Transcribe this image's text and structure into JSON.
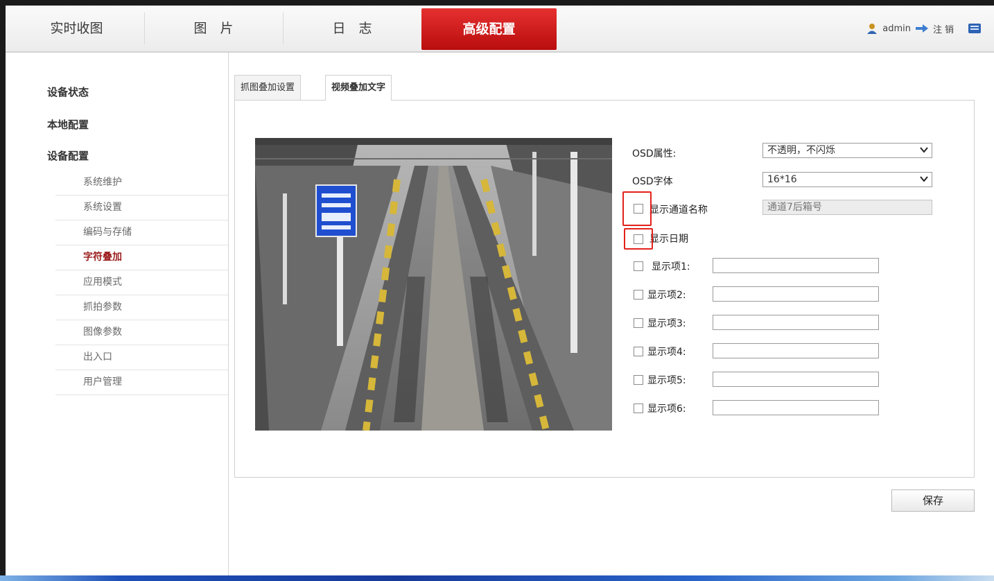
{
  "nav": {
    "tabs": [
      {
        "label": "实时收图"
      },
      {
        "label": "图　片"
      },
      {
        "label": "日　志"
      },
      {
        "label": "高级配置"
      }
    ],
    "user": "admin",
    "logout": "注销"
  },
  "sidebar": {
    "sections": [
      "设备状态",
      "本地配置",
      "设备配置"
    ],
    "items": [
      {
        "label": "系统维护"
      },
      {
        "label": "系统设置"
      },
      {
        "label": "编码与存储"
      },
      {
        "label": "字符叠加"
      },
      {
        "label": "应用模式"
      },
      {
        "label": "抓拍参数"
      },
      {
        "label": "图像参数"
      },
      {
        "label": "出入口"
      },
      {
        "label": "用户管理"
      }
    ],
    "current": "字符叠加"
  },
  "content": {
    "tabs": [
      {
        "label": "抓图叠加设置"
      },
      {
        "label": "视频叠加文字"
      }
    ],
    "active_tab": "视频叠加文字"
  },
  "osd": {
    "attr_label": "OSD属性:",
    "attr_value": "不透明，不闪烁",
    "font_label": "OSD字体",
    "font_value": "16*16",
    "show_channel_label": "显示通道名称",
    "channel_name": "通道7后箱号",
    "show_date_label": "显示日期",
    "items": [
      {
        "label": "显示项1:",
        "value": ""
      },
      {
        "label": "显示项2:",
        "value": ""
      },
      {
        "label": "显示项3:",
        "value": ""
      },
      {
        "label": "显示项4:",
        "value": ""
      },
      {
        "label": "显示项5:",
        "value": ""
      },
      {
        "label": "显示项6:",
        "value": ""
      }
    ]
  },
  "actions": {
    "save_label": "保存"
  },
  "colors": {
    "accent": "#c41616",
    "highlight": "#e3211b"
  }
}
